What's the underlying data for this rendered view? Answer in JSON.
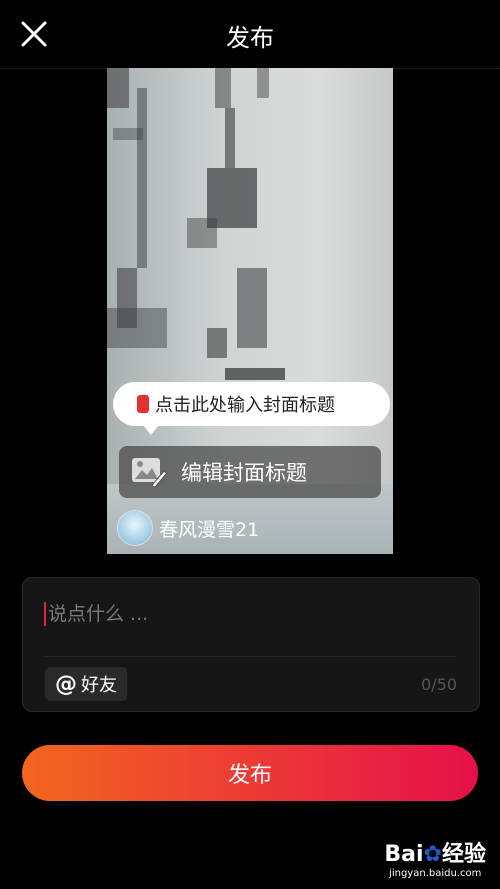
{
  "header": {
    "title": "发布",
    "close_icon": "close-icon"
  },
  "cover": {
    "tooltip_text": "点击此处输入封面标题",
    "tooltip_mark_color": "#e53333",
    "edit_title_label": "编辑封面标题",
    "edit_icon": "image-edit-icon",
    "username": "春风漫雪21"
  },
  "description": {
    "placeholder": "说点什么 ...",
    "value": "",
    "friend_button_label": "好友",
    "at_symbol": "@",
    "counter": "0/50"
  },
  "publish": {
    "label": "发布",
    "gradient_start": "#f2661f",
    "gradient_end": "#e5104a"
  },
  "watermark": {
    "logo_text_1": "Bai",
    "logo_text_2": "经验",
    "url": "jingyan.baidu.com"
  }
}
